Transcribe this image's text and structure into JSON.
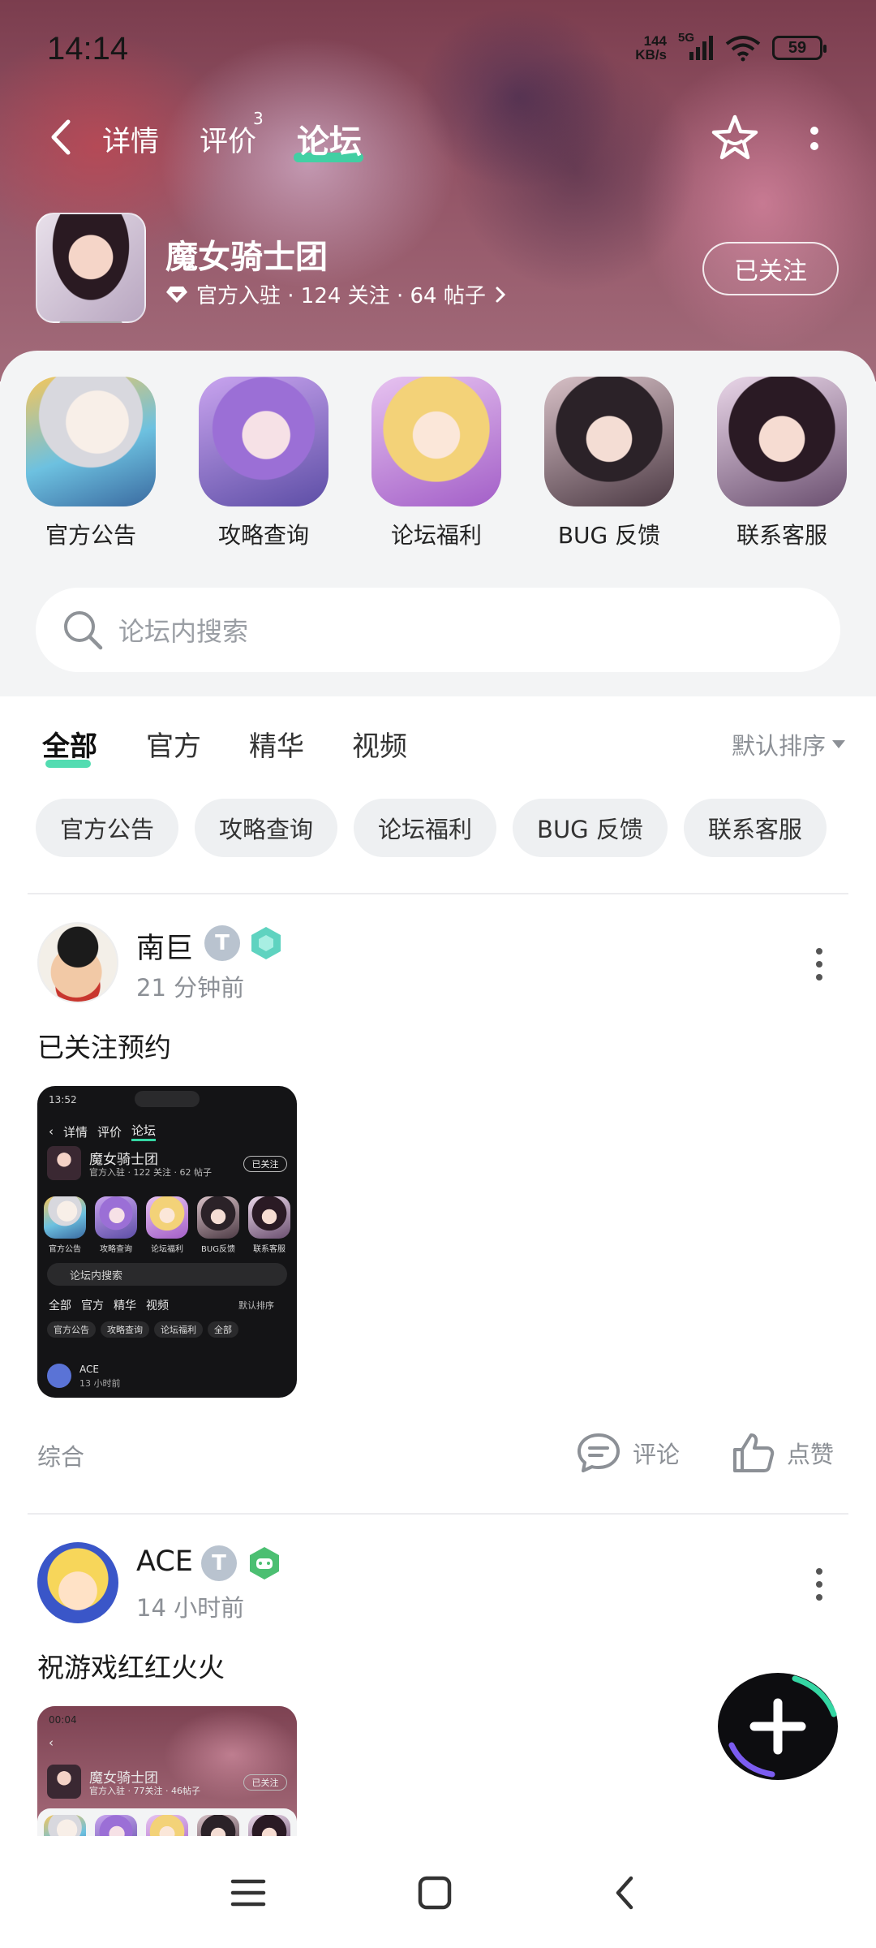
{
  "status_bar": {
    "time": "14:14",
    "net_speed_value": "144",
    "net_speed_unit": "KB/s",
    "network": "5G",
    "battery": "59"
  },
  "nav": {
    "tabs": [
      {
        "label": "详情"
      },
      {
        "label": "评价",
        "badge": "3"
      },
      {
        "label": "论坛"
      }
    ],
    "active_tab": "论坛"
  },
  "game": {
    "name": "魔女骑士团",
    "meta": "官方入驻 · 124 关注 · 64 帖子",
    "follow_label": "已关注"
  },
  "quick_links": [
    {
      "label": "官方公告"
    },
    {
      "label": "攻略查询"
    },
    {
      "label": "论坛福利"
    },
    {
      "label": "BUG 反馈"
    },
    {
      "label": "联系客服"
    }
  ],
  "search": {
    "placeholder": "论坛内搜索"
  },
  "filter_tabs": [
    {
      "label": "全部"
    },
    {
      "label": "官方"
    },
    {
      "label": "精华"
    },
    {
      "label": "视频"
    }
  ],
  "sort_label": "默认排序",
  "chips": [
    "官方公告",
    "攻略查询",
    "论坛福利",
    "BUG 反馈",
    "联系客服"
  ],
  "posts": [
    {
      "author": "南巨",
      "time": "21 分钟前",
      "title": "已关注预约",
      "category": "综合",
      "comment_label": "评论",
      "like_label": "点赞",
      "thumb": {
        "status_time": "13:52",
        "tabs": [
          "详情",
          "评价",
          "论坛"
        ],
        "game_name": "魔女骑士团",
        "meta": "官方入驻 · 122 关注 · 62 帖子",
        "follow": "已关注",
        "icons": [
          "官方公告",
          "攻略查询",
          "论坛福利",
          "BUG反馈",
          "联系客服"
        ],
        "search": "论坛内搜索",
        "tabs2": [
          "全部",
          "官方",
          "精华",
          "视频"
        ],
        "sort": "默认排序",
        "chips": [
          "官方公告",
          "攻略查询",
          "论坛福利",
          "全部"
        ],
        "user": "ACE",
        "user_time": "13 小时前"
      }
    },
    {
      "author": "ACE",
      "time": "14 小时前",
      "title": "祝游戏红红火火",
      "thumb": {
        "status_time": "00:04",
        "game_name": "魔女骑士团",
        "meta": "官方入驻 · 77关注 · 46帖子",
        "follow": "已关注"
      }
    }
  ],
  "colors": {
    "accent": "#35d6a3",
    "hero": "#8d4c5f",
    "muted": "#8c9096"
  }
}
